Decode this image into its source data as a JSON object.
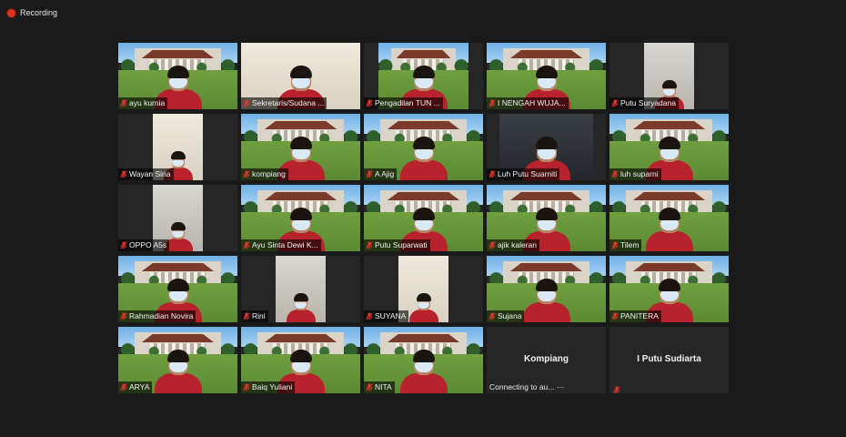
{
  "recording": {
    "label": "Recording"
  },
  "participants": [
    {
      "name": "ayu kurnia",
      "scene": "campus"
    },
    {
      "name": "Sekretaris/Sudana ...",
      "scene": "indoor"
    },
    {
      "name": "Pengadilan TUN ...",
      "scene": "campus"
    },
    {
      "name": "I NENGAH WUJA...",
      "scene": "campus"
    },
    {
      "name": "Putu Suryadana",
      "scene": "indoor"
    },
    {
      "name": "Wayan Sina",
      "scene": "indoor"
    },
    {
      "name": "kompiang",
      "scene": "campus"
    },
    {
      "name": "A Ajig",
      "scene": "campus"
    },
    {
      "name": "Luh Putu Suarniti",
      "scene": "indoor-dark"
    },
    {
      "name": "luh suparni",
      "scene": "campus"
    },
    {
      "name": "OPPO A5s",
      "scene": "indoor"
    },
    {
      "name": "Ayu Sinta Dewi K...",
      "scene": "campus"
    },
    {
      "name": "Putu Suparwati",
      "scene": "campus"
    },
    {
      "name": "ajik kaleran",
      "scene": "campus"
    },
    {
      "name": "Tilem",
      "scene": "campus"
    },
    {
      "name": "Rahmadian Novira",
      "scene": "campus"
    },
    {
      "name": "Rini",
      "scene": "indoor"
    },
    {
      "name": "SUYANA",
      "scene": "indoor"
    },
    {
      "name": "Sujana",
      "scene": "campus"
    },
    {
      "name": "PANITERA",
      "scene": "campus"
    },
    {
      "name": "ARYA",
      "scene": "campus"
    },
    {
      "name": "Baiq Yuliani",
      "scene": "campus"
    },
    {
      "name": "NITA",
      "scene": "campus"
    },
    {
      "name": "Kompiang",
      "scene": "none",
      "status": "Connecting to au... ···"
    },
    {
      "name": "I Putu Sudiarta",
      "scene": "none"
    }
  ],
  "colors": {
    "mic_muted": "#e5332a",
    "shirt": "#b8222c"
  },
  "icons": {
    "muted": "mic-muted-icon",
    "recording": "recording-dot-icon"
  }
}
